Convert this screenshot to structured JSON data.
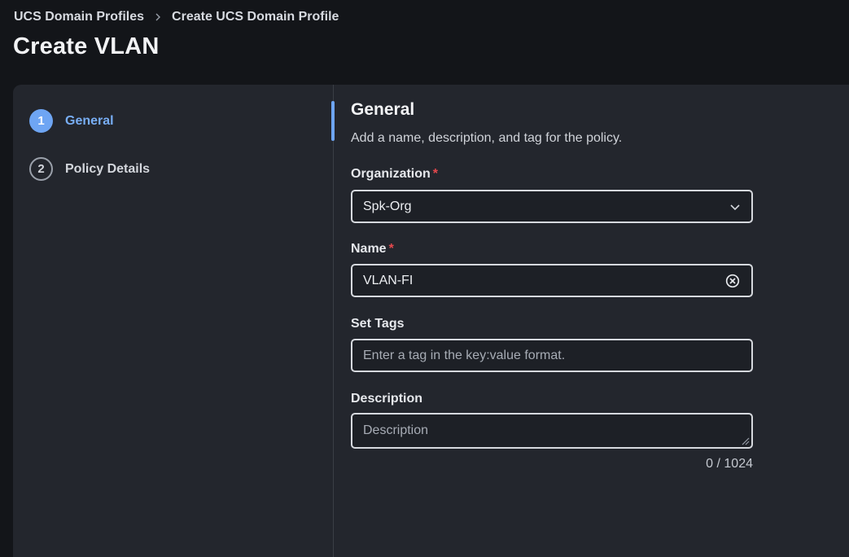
{
  "breadcrumb": {
    "items": [
      "UCS Domain Profiles",
      "Create UCS Domain Profile"
    ]
  },
  "page_title": "Create VLAN",
  "steps": [
    {
      "number": "1",
      "label": "General",
      "active": true
    },
    {
      "number": "2",
      "label": "Policy Details",
      "active": false
    }
  ],
  "form": {
    "title": "General",
    "subtitle": "Add a name, description, and tag for the policy.",
    "organization": {
      "label": "Organization",
      "required_mark": "*",
      "value": "Spk-Org"
    },
    "name": {
      "label": "Name",
      "required_mark": "*",
      "value": "VLAN-FI"
    },
    "tags": {
      "label": "Set Tags",
      "placeholder": "Enter a tag in the key:value format."
    },
    "description": {
      "label": "Description",
      "placeholder": "Description",
      "counter": "0 / 1024"
    }
  },
  "colors": {
    "accent": "#6ea5f3",
    "required": "#e5484d",
    "background": "#131519",
    "panel": "#23262d"
  },
  "icons": [
    "chevron-right-icon",
    "chevron-down-icon",
    "clear-circle-icon",
    "resize-grip-icon"
  ]
}
